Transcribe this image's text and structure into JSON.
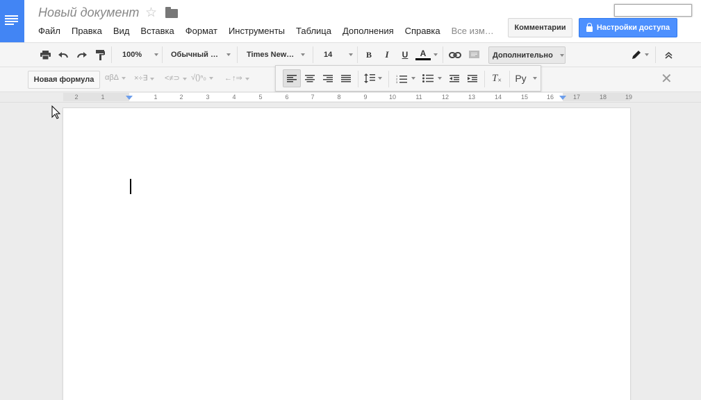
{
  "header": {
    "doc_title": "Новый документ",
    "menu": [
      "Файл",
      "Правка",
      "Вид",
      "Вставка",
      "Формат",
      "Инструменты",
      "Таблица",
      "Дополнения",
      "Справка"
    ],
    "last_edit": "Все изм…",
    "comments_label": "Комментарии",
    "share_label": "Настройки доступа"
  },
  "toolbar": {
    "zoom": "100%",
    "style": "Обычный …",
    "font": "Times New…",
    "size": "14",
    "more_label": "Дополнительно"
  },
  "eqbar": {
    "formula_label": "Новая формула",
    "groups": [
      "αβΔ",
      "×÷∃",
      "<≠⊃",
      "√()ⁿ₀",
      "←↑⇒"
    ]
  },
  "floating": {
    "lang_label": "Ру"
  },
  "ruler": {
    "numbers": [
      "2",
      "1",
      "1",
      "2",
      "3",
      "4",
      "5",
      "6",
      "7",
      "8",
      "9",
      "10",
      "11",
      "12",
      "13",
      "14",
      "15",
      "16",
      "17",
      "18",
      "19"
    ]
  },
  "colors": {
    "brand": "#4285f4",
    "share_button": "#4d90fe",
    "indent_marker": "#6d9eeb"
  }
}
